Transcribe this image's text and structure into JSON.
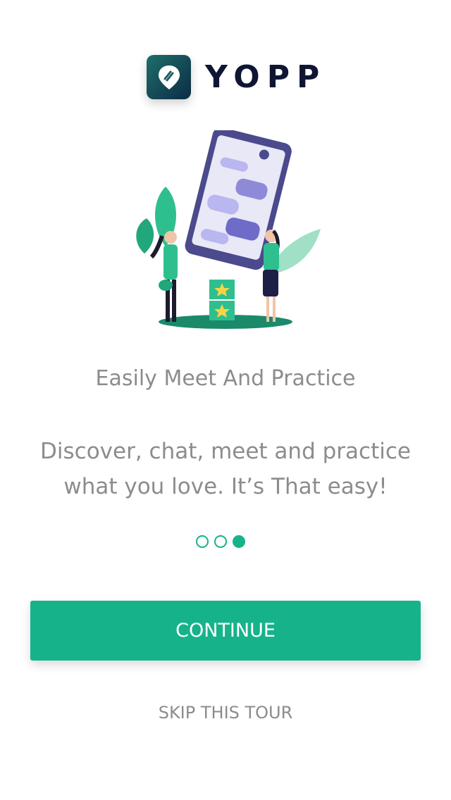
{
  "app": {
    "brand_name": "YOPP",
    "logo_icon": "location-pin-icon"
  },
  "onboarding": {
    "headline": "Easily Meet And Practice",
    "description": "Discover, chat, meet and practice what you love. It’s That easy!",
    "page_indicator": {
      "total": 3,
      "current": 3
    },
    "continue_label": "CONTINUE",
    "skip_label": "SKIP THIS TOUR",
    "illustration": "people-chatting-on-phone-illustration"
  },
  "colors": {
    "accent": "#16b38a",
    "text_muted": "#8c8c8c",
    "brand_dark": "#0f1634",
    "phone_purple": "#4a4a8c"
  }
}
